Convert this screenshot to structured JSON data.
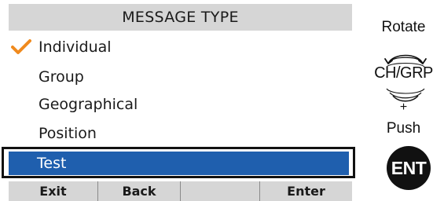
{
  "screen": {
    "title": "MESSAGE TYPE",
    "items": [
      {
        "label": "Individual",
        "checked": true
      },
      {
        "label": "Group",
        "checked": false
      },
      {
        "label": "Geographical",
        "checked": false
      },
      {
        "label": "Position",
        "checked": false
      },
      {
        "label": "Test",
        "selected": true
      }
    ],
    "softkeys": [
      "Exit",
      "Back",
      "",
      "Enter"
    ]
  },
  "instructions": {
    "rotate": "Rotate",
    "dial_label": "CH/GRP",
    "plus": "+",
    "push": "Push",
    "button_label": "ENT"
  },
  "colors": {
    "selection": "#1f5fae",
    "check": "#f08a1e",
    "bar": "#d6d6d6"
  }
}
